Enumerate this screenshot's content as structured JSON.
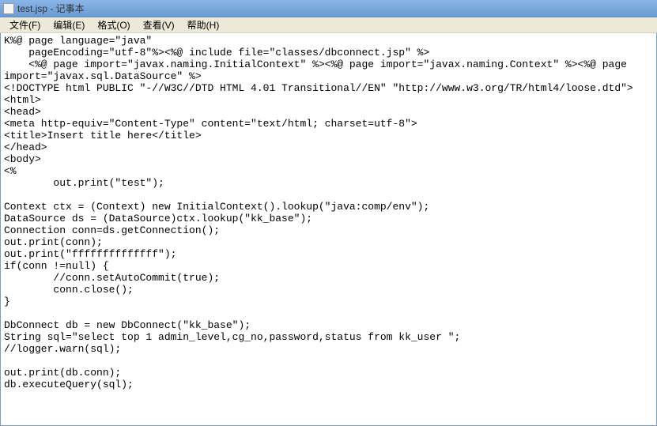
{
  "window": {
    "title": "test.jsp - 记事本",
    "icon": "notepad-icon"
  },
  "menu": {
    "file": "文件(F)",
    "edit": "编辑(E)",
    "format": "格式(O)",
    "view": "查看(V)",
    "help": "帮助(H)"
  },
  "content": {
    "text": "K%@ page language=\"java\"\n    pageEncoding=\"utf-8\"%><%@ include file=\"classes/dbconnect.jsp\" %>\n    <%@ page import=\"javax.naming.InitialContext\" %><%@ page import=\"javax.naming.Context\" %><%@ page\nimport=\"javax.sql.DataSource\" %>\n<!DOCTYPE html PUBLIC \"-//W3C//DTD HTML 4.01 Transitional//EN\" \"http://www.w3.org/TR/html4/loose.dtd\">\n<html>\n<head>\n<meta http-equiv=\"Content-Type\" content=\"text/html; charset=utf-8\">\n<title>Insert title here</title>\n</head>\n<body>\n<%\n        out.print(\"test\");\n\nContext ctx = (Context) new InitialContext().lookup(\"java:comp/env\");\nDataSource ds = (DataSource)ctx.lookup(\"kk_base\");\nConnection conn=ds.getConnection();\nout.print(conn);\nout.print(\"ffffffffffffff\");\nif(conn !=null) {\n        //conn.setAutoCommit(true);\n        conn.close();\n}\n\nDbConnect db = new DbConnect(\"kk_base\");\nString sql=\"select top 1 admin_level,cg_no,password,status from kk_user \";\n//logger.warn(sql);\n\nout.print(db.conn);\ndb.executeQuery(sql);"
  }
}
